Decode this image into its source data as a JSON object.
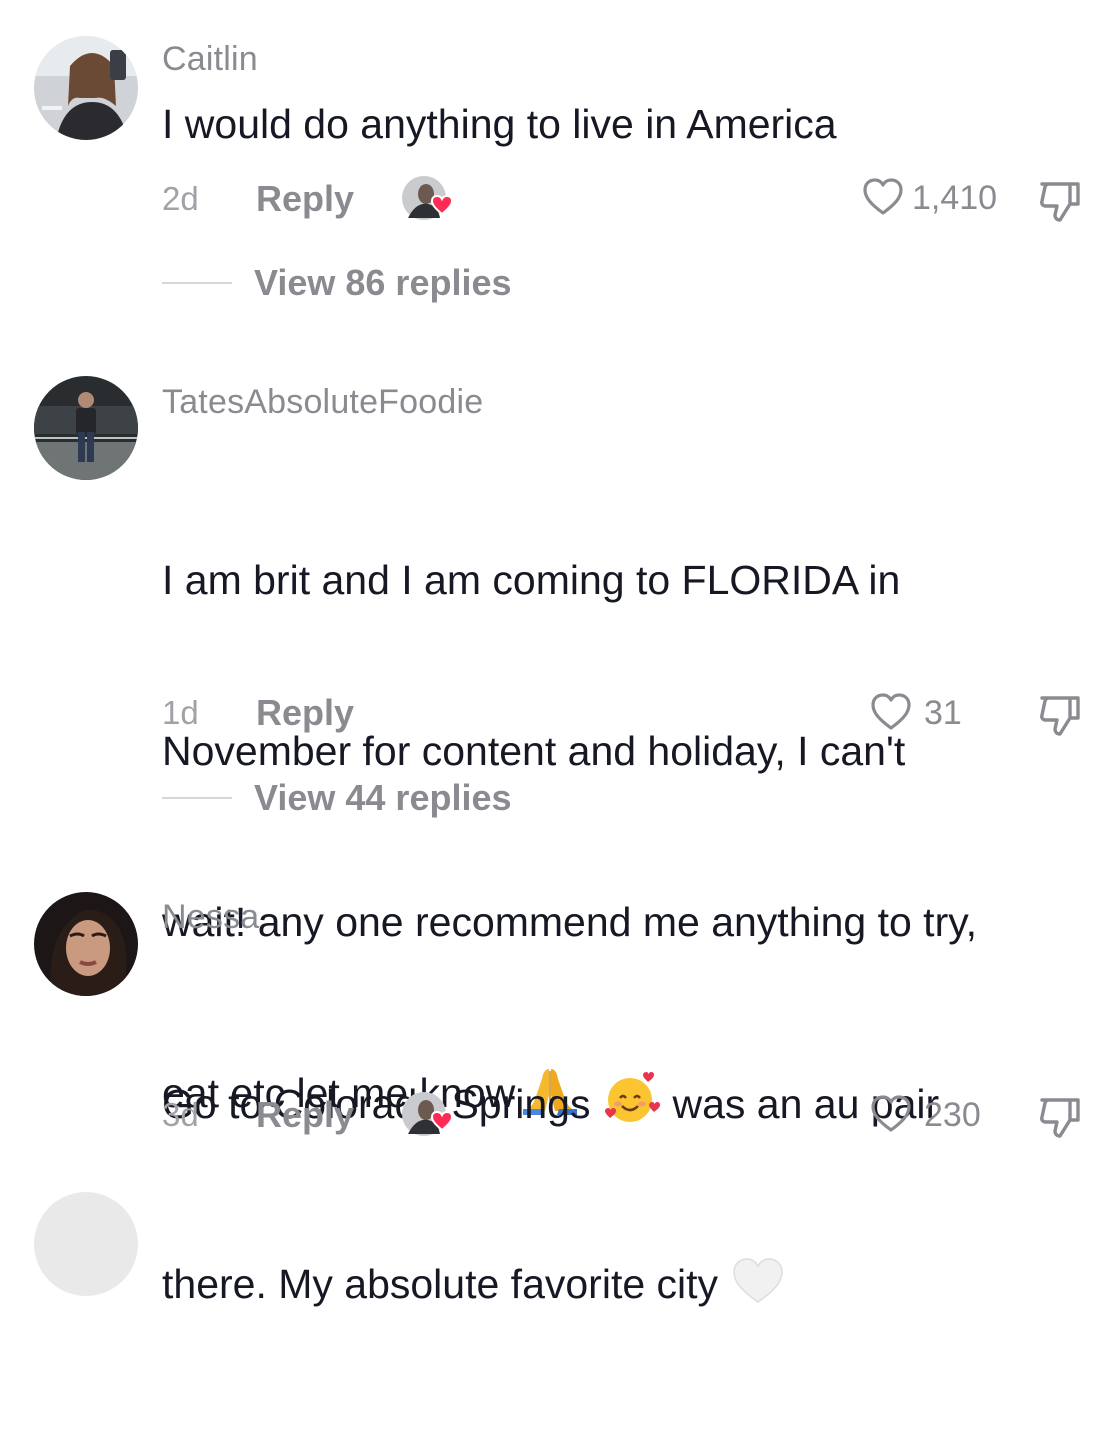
{
  "comments": [
    {
      "username": "Caitlin",
      "text": "I would do anything to live in America",
      "time": "2d",
      "reply_label": "Reply",
      "likes": "1,410",
      "creator_liked": true,
      "view_replies": "View 86 replies"
    },
    {
      "username": "TatesAbsoluteFoodie",
      "text_lines": [
        "I am brit and I am coming to FLORIDA in",
        "November for content and holiday, I can't",
        "wait! any one recommend me anything to try,",
        "eat etc let me know"
      ],
      "text_emoji": "folded-hands",
      "time": "1d",
      "reply_label": "Reply",
      "likes": "31",
      "creator_liked": false,
      "view_replies": "View 44 replies"
    },
    {
      "username": "Nessa",
      "text_part1": "Go to Colorado Springs",
      "text_emoji1": "smiling-face-with-hearts",
      "text_part2": "was an au pair",
      "text_line2": "there. My absolute favorite city",
      "text_emoji2": "white-heart",
      "time": "3d",
      "reply_label": "Reply",
      "likes": "230",
      "creator_liked": true
    }
  ],
  "colors": {
    "text": "#161823",
    "secondary": "#8a8b91",
    "heart_red": "#fe2c55"
  }
}
